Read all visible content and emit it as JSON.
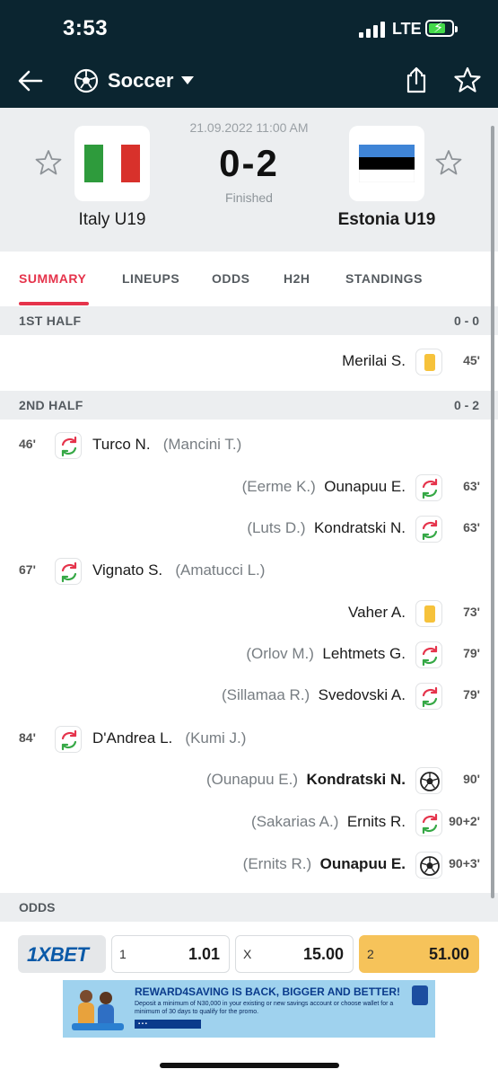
{
  "status_bar": {
    "time": "3:53",
    "network": "LTE"
  },
  "nav": {
    "sport": "Soccer",
    "back_icon": "arrow-left-icon",
    "share_icon": "share-icon",
    "favorite_icon": "star-icon"
  },
  "match": {
    "date": "21.09.2022 11:00 AM",
    "score": "0-2",
    "status": "Finished",
    "home": {
      "name": "Italy U19",
      "flag_colors": [
        "#2e9b3c",
        "#ffffff",
        "#d8312b"
      ]
    },
    "away": {
      "name": "Estonia U19",
      "flag_colors": [
        "#3f84d6",
        "#000000",
        "#ffffff"
      ]
    }
  },
  "tabs": [
    "SUMMARY",
    "LINEUPS",
    "ODDS",
    "H2H",
    "STANDINGS"
  ],
  "sections": {
    "first_half": {
      "label": "1ST HALF",
      "score": "0 - 0"
    },
    "second_half": {
      "label": "2ND HALF",
      "score": "0 - 2"
    }
  },
  "events": [
    {
      "minute": "45'",
      "side": "away",
      "type": "yellow-card",
      "player": "Merilai S.",
      "assist": "",
      "bold": false
    },
    {
      "minute": "46'",
      "side": "home",
      "type": "substitution",
      "player": "Turco N.",
      "assist": "(Mancini T.)",
      "bold": false
    },
    {
      "minute": "63'",
      "side": "away",
      "type": "substitution",
      "player": "Ounapuu E.",
      "assist": "(Eerme K.)",
      "bold": false
    },
    {
      "minute": "63'",
      "side": "away",
      "type": "substitution",
      "player": "Kondratski N.",
      "assist": "(Luts D.)",
      "bold": false
    },
    {
      "minute": "67'",
      "side": "home",
      "type": "substitution",
      "player": "Vignato S.",
      "assist": "(Amatucci L.)",
      "bold": false
    },
    {
      "minute": "73'",
      "side": "away",
      "type": "yellow-card",
      "player": "Vaher A.",
      "assist": "",
      "bold": false
    },
    {
      "minute": "79'",
      "side": "away",
      "type": "substitution",
      "player": "Lehtmets G.",
      "assist": "(Orlov M.)",
      "bold": false
    },
    {
      "minute": "79'",
      "side": "away",
      "type": "substitution",
      "player": "Svedovski A.",
      "assist": "(Sillamaa R.)",
      "bold": false
    },
    {
      "minute": "84'",
      "side": "home",
      "type": "substitution",
      "player": "D'Andrea L.",
      "assist": "(Kumi J.)",
      "bold": false
    },
    {
      "minute": "90'",
      "side": "away",
      "type": "goal",
      "player": "Kondratski N.",
      "assist": "(Ounapuu E.)",
      "bold": true
    },
    {
      "minute": "90+2'",
      "side": "away",
      "type": "substitution",
      "player": "Ernits R.",
      "assist": "(Sakarias A.)",
      "bold": false
    },
    {
      "minute": "90+3'",
      "side": "away",
      "type": "goal",
      "player": "Ounapuu E.",
      "assist": "(Ernits R.)",
      "bold": true
    }
  ],
  "odds": {
    "label": "ODDS",
    "bookmaker": "1XBET",
    "items": [
      {
        "key": "1",
        "value": "1.01"
      },
      {
        "key": "X",
        "value": "15.00"
      },
      {
        "key": "2",
        "value": "51.00"
      }
    ],
    "highlight_color": "#f6c35a"
  },
  "banner": {
    "title": "REWARD4SAVING IS BACK, BIGGER AND BETTER!",
    "text": "Deposit a minimum of N30,000 in your existing or new savings account or choose wallet for a minimum of 30 days to qualify for the promo."
  },
  "colors": {
    "accent": "#e5334b",
    "header_bg": "#0b2530",
    "section_bg": "#eceef0"
  }
}
